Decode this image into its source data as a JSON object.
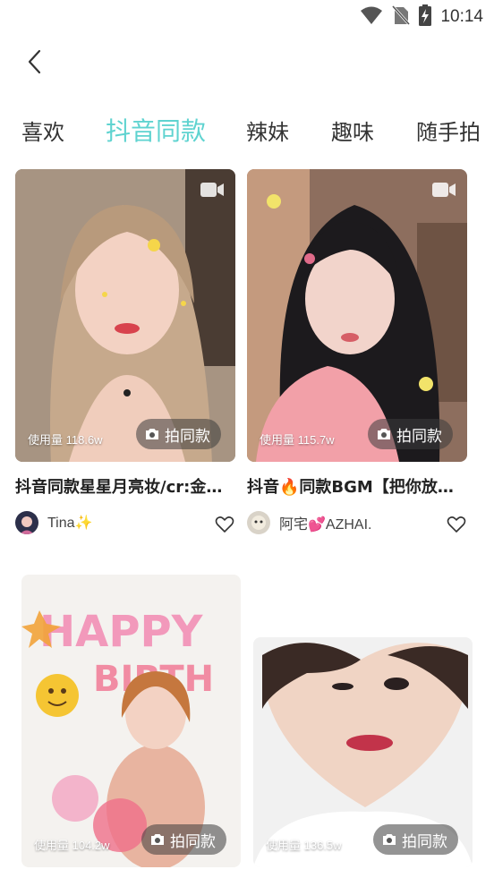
{
  "status_bar": {
    "time": "10:14"
  },
  "tabs": [
    {
      "label": "喜欢",
      "active": false
    },
    {
      "label": "抖音同款",
      "active": true
    },
    {
      "label": "辣妹",
      "active": false
    },
    {
      "label": "趣味",
      "active": false
    },
    {
      "label": "随手拍",
      "active": false
    }
  ],
  "colors": {
    "accent": "#5fd3d0"
  },
  "cards": [
    {
      "usage": "使用量 118.6w",
      "shoot_label": "拍同款",
      "title": "抖音同款星星月亮妆/cr:金…",
      "author": "Tina✨",
      "has_video_icon": true
    },
    {
      "usage": "使用量 115.7w",
      "shoot_label": "拍同款",
      "title": "抖音🔥同款BGM【把你放…",
      "author": "阿宅💕AZHAI.",
      "has_video_icon": true
    },
    {
      "usage": "使用量 104.2w",
      "shoot_label": "拍同款"
    },
    {
      "usage": "使用量 136.5w",
      "shoot_label": "拍同款"
    }
  ]
}
